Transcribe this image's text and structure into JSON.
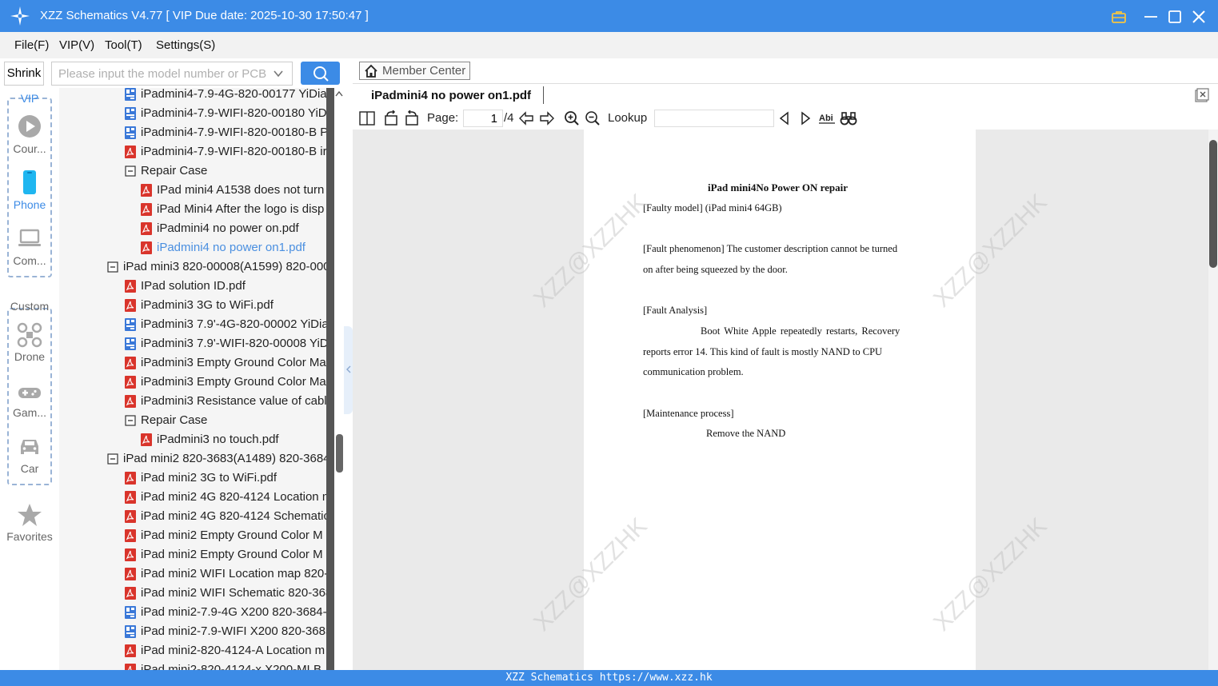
{
  "window": {
    "title": "XZZ Schematics V4.77 [ VIP Due date: 2025-10-30 17:50:47 ]"
  },
  "menu": [
    "File(F)",
    "VIP(V)",
    "Tool(T)",
    "Settings(S)"
  ],
  "search": {
    "shrink_label": "Shrink",
    "placeholder": "Please input the model number or PCB"
  },
  "categories": {
    "vip_label": "VIP",
    "custom_label": "Custom",
    "items": [
      {
        "label": "Cour...",
        "icon": "play-circle-icon"
      },
      {
        "label": "Phone",
        "icon": "phone-icon",
        "active": true
      },
      {
        "label": "Com...",
        "icon": "laptop-icon"
      },
      {
        "label": "Drone",
        "icon": "drone-icon"
      },
      {
        "label": "Gam...",
        "icon": "gamepad-icon"
      },
      {
        "label": "Car",
        "icon": "car-icon"
      },
      {
        "label": "Favorites",
        "icon": "star-icon"
      }
    ]
  },
  "tree": [
    {
      "label": "iPadmini4-7.9-4G-820-00177 YiDia",
      "type": "board",
      "indent": 2
    },
    {
      "label": "iPadmini4-7.9-WIFI-820-00180 YiD",
      "type": "board",
      "indent": 2
    },
    {
      "label": "iPadmini4-7.9-WIFI-820-00180-B P",
      "type": "board",
      "indent": 2
    },
    {
      "label": "iPadmini4-7.9-WIFI-820-00180-B ir",
      "type": "pdf",
      "indent": 2
    },
    {
      "label": "Repair Case",
      "type": "folder",
      "indent": 2
    },
    {
      "label": "IPad mini4 A1538 does not turn",
      "type": "pdf",
      "indent": 3
    },
    {
      "label": "iPad Mini4 After the logo is disp",
      "type": "pdf",
      "indent": 3
    },
    {
      "label": "iPadmini4 no power on.pdf",
      "type": "pdf",
      "indent": 3
    },
    {
      "label": "iPadmini4 no power on1.pdf",
      "type": "pdf",
      "indent": 3,
      "selected": true
    },
    {
      "label": "iPad mini3 820-00008(A1599) 820-000",
      "type": "folder",
      "indent": 1
    },
    {
      "label": "IPad solution ID.pdf",
      "type": "pdf",
      "indent": 2
    },
    {
      "label": "iPadmini3 3G to WiFi.pdf",
      "type": "pdf",
      "indent": 2
    },
    {
      "label": "iPadmini3 7.9'-4G-820-00002 YiDia",
      "type": "board",
      "indent": 2
    },
    {
      "label": "iPadmini3 7.9'-WIFI-820-00008 YiD",
      "type": "board",
      "indent": 2
    },
    {
      "label": "iPadmini3 Empty Ground Color Ma",
      "type": "pdf",
      "indent": 2
    },
    {
      "label": "iPadmini3 Empty Ground Color Ma",
      "type": "pdf",
      "indent": 2
    },
    {
      "label": "iPadmini3 Resistance value of cabl",
      "type": "pdf",
      "indent": 2
    },
    {
      "label": "Repair Case",
      "type": "folder",
      "indent": 2
    },
    {
      "label": "iPadmini3 no touch.pdf",
      "type": "pdf",
      "indent": 3
    },
    {
      "label": "iPad mini2 820-3683(A1489) 820-3684",
      "type": "folder",
      "indent": 1
    },
    {
      "label": "iPad mini2 3G to WiFi.pdf",
      "type": "pdf",
      "indent": 2
    },
    {
      "label": "iPad mini2 4G 820-4124 Location m",
      "type": "pdf",
      "indent": 2
    },
    {
      "label": "iPad mini2 4G 820-4124 Schematic",
      "type": "pdf",
      "indent": 2
    },
    {
      "label": "iPad mini2 Empty Ground Color M",
      "type": "pdf",
      "indent": 2
    },
    {
      "label": "iPad mini2 Empty Ground Color M",
      "type": "pdf",
      "indent": 2
    },
    {
      "label": "iPad mini2 WIFI Location map 820-",
      "type": "pdf",
      "indent": 2
    },
    {
      "label": "iPad mini2 WIFI Schematic 820-368",
      "type": "pdf",
      "indent": 2
    },
    {
      "label": "iPad mini2-7.9-4G X200 820-3684-",
      "type": "board",
      "indent": 2
    },
    {
      "label": "iPad mini2-7.9-WIFI X200 820-3683",
      "type": "board",
      "indent": 2
    },
    {
      "label": "iPad mini2-820-4124-A Location m",
      "type": "pdf",
      "indent": 2
    },
    {
      "label": "iPad mini2-820-4124-x X200-MLB",
      "type": "pdf",
      "indent": 2
    }
  ],
  "right": {
    "member_center": "Member Center",
    "tab_title": "iPadmini4 no power on1.pdf",
    "page_label": "Page:",
    "page_value": "1",
    "page_total": "/4",
    "lookup_label": "Lookup"
  },
  "document": {
    "title": "iPad mini4No Power ON repair",
    "lines": [
      "[Faulty model] (iPad mini4 64GB)",
      "[Fault phenomenon] The customer description cannot be turned",
      "on after being squeezed by the door.",
      "[Fault Analysis]",
      "Boot  White  Apple  repeatedly  restarts,  Recovery",
      "reports  error  14.  This  kind  of  fault  is  mostly  NAND  to  CPU",
      "communication problem.",
      "[Maintenance process]",
      "Remove the NAND"
    ],
    "watermark": "XZZ@XZZHK"
  },
  "status": {
    "text": "XZZ Schematics https://www.xzz.hk"
  },
  "colors": {
    "accent": "#3c8be6",
    "pdf_red": "#d9342b",
    "board_blue": "#3a78d8",
    "selected_text": "#4a8fe0"
  }
}
